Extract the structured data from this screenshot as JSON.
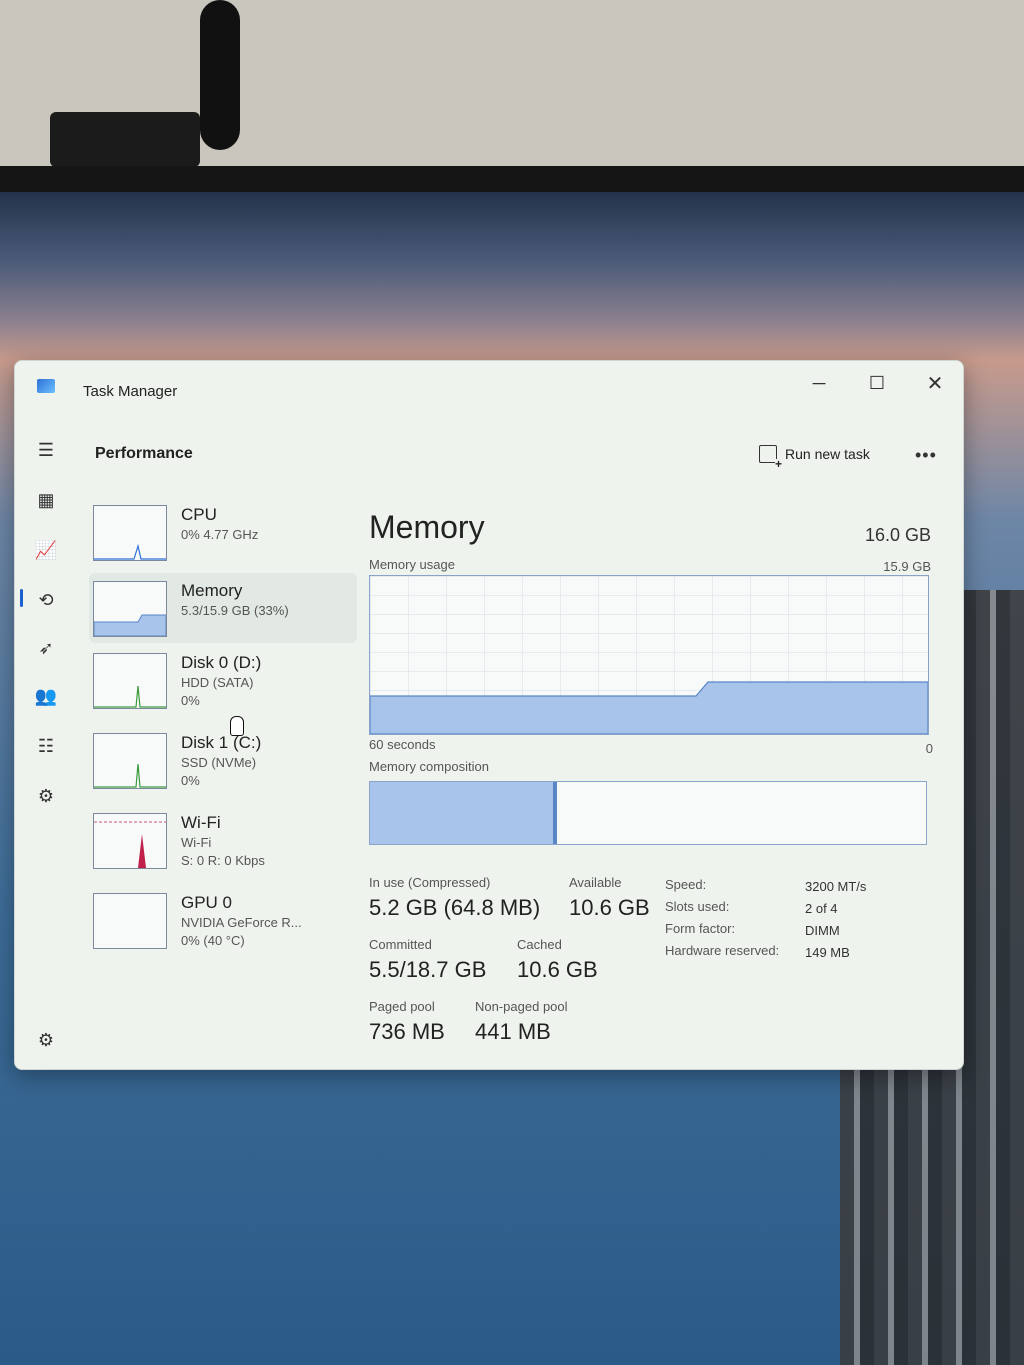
{
  "window": {
    "title": "Task Manager",
    "min_label": "─",
    "max_label": "☐",
    "close_label": "✕"
  },
  "nav": [
    {
      "icon": "hamburger-menu-icon",
      "glyph": "☰"
    },
    {
      "icon": "processes-icon",
      "glyph": "▦"
    },
    {
      "icon": "performance-icon",
      "glyph": "📈"
    },
    {
      "icon": "app-history-icon",
      "glyph": "⟲"
    },
    {
      "icon": "startup-apps-icon",
      "glyph": "➶"
    },
    {
      "icon": "users-icon",
      "glyph": "👥"
    },
    {
      "icon": "details-icon",
      "glyph": "☷"
    },
    {
      "icon": "services-icon",
      "glyph": "⚙"
    },
    {
      "icon": "settings-icon",
      "glyph": "⚙"
    }
  ],
  "header": {
    "title": "Performance",
    "run_new_task": "Run new task",
    "more": "•••"
  },
  "devices": [
    {
      "name": "CPU",
      "sub1": "0% 4.77 GHz",
      "sub2": "",
      "graph_color": "#2f6fd6",
      "level": 0.02
    },
    {
      "name": "Memory",
      "sub1": "5.3/15.9 GB (33%)",
      "sub2": "",
      "graph_color": "#5a86c8",
      "level": 0.33
    },
    {
      "name": "Disk 0 (D:)",
      "sub1": "HDD (SATA)",
      "sub2": "0%",
      "graph_color": "#3a9a3a",
      "level": 0.0
    },
    {
      "name": "Disk 1 (C:)",
      "sub1": "SSD (NVMe)",
      "sub2": "0%",
      "graph_color": "#3a9a3a",
      "level": 0.0
    },
    {
      "name": "Wi-Fi",
      "sub1": "Wi-Fi",
      "sub2": "S: 0 R: 0 Kbps",
      "graph_color": "#c0204a",
      "level": 0.0
    },
    {
      "name": "GPU 0",
      "sub1": "NVIDIA GeForce R...",
      "sub2": "0% (40 °C)",
      "graph_color": "#3a6fb0",
      "level": 0.0
    }
  ],
  "memory": {
    "title": "Memory",
    "total": "16.0 GB",
    "usage_label": "Memory usage",
    "usage_max": "15.9 GB",
    "time_label": "60 seconds",
    "time_zero": "0",
    "composition_label": "Memory composition",
    "in_use_fraction": 0.33,
    "stats": {
      "in_use_lbl": "In use (Compressed)",
      "in_use_val": "5.2 GB (64.8 MB)",
      "available_lbl": "Available",
      "available_val": "10.6 GB",
      "committed_lbl": "Committed",
      "committed_val": "5.5/18.7 GB",
      "cached_lbl": "Cached",
      "cached_val": "10.6 GB",
      "paged_lbl": "Paged pool",
      "paged_val": "736 MB",
      "nonpaged_lbl": "Non-paged pool",
      "nonpaged_val": "441 MB"
    },
    "specs": [
      {
        "label": "Speed:",
        "value": "3200 MT/s"
      },
      {
        "label": "Slots used:",
        "value": "2 of 4"
      },
      {
        "label": "Form factor:",
        "value": "DIMM"
      },
      {
        "label": "Hardware reserved:",
        "value": "149 MB"
      }
    ]
  },
  "colors": {
    "accent": "#1e5fd0",
    "memory_fill": "#a8c4ea",
    "memory_line": "#5a86c8"
  }
}
